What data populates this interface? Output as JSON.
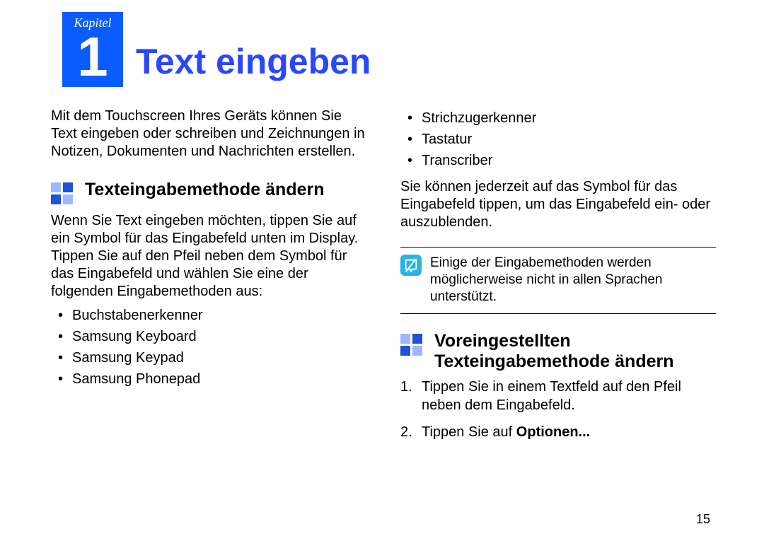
{
  "chapter": {
    "label": "Kapitel",
    "number": "1"
  },
  "title": "Text eingeben",
  "left": {
    "intro": "Mit dem Touchscreen Ihres Geräts können Sie Text eingeben oder schreiben und Zeichnungen in Notizen, Dokumenten und Nachrichten erstellen.",
    "section1": {
      "title": "Texteingabemethode ändern",
      "body": "Wenn Sie Text eingeben möchten, tippen Sie auf ein Symbol für das Eingabefeld unten im Display. Tippen Sie auf den Pfeil neben dem Symbol für das Eingabefeld und wählen Sie eine der folgenden Eingabemethoden aus:",
      "bullets": [
        "Buchstabenerkenner",
        "Samsung Keyboard",
        "Samsung Keypad",
        "Samsung Phonepad"
      ]
    }
  },
  "right": {
    "bullets_cont": [
      "Strichzugerkenner",
      "Tastatur",
      "Transcriber"
    ],
    "para_after": "Sie können jederzeit auf das Symbol für das Eingabefeld tippen, um das Eingabefeld ein- oder auszublenden.",
    "note": "Einige der Eingabemethoden werden möglicherweise nicht in allen Sprachen unterstützt.",
    "section2": {
      "title": "Voreingestellten Texteingabemethode ändern",
      "steps": [
        {
          "n": "1.",
          "text": "Tippen Sie in einem Textfeld auf den Pfeil neben dem Eingabefeld."
        },
        {
          "n": "2.",
          "prefix": "Tippen Sie auf ",
          "bold": "Optionen..."
        }
      ]
    }
  },
  "page_number": "15"
}
